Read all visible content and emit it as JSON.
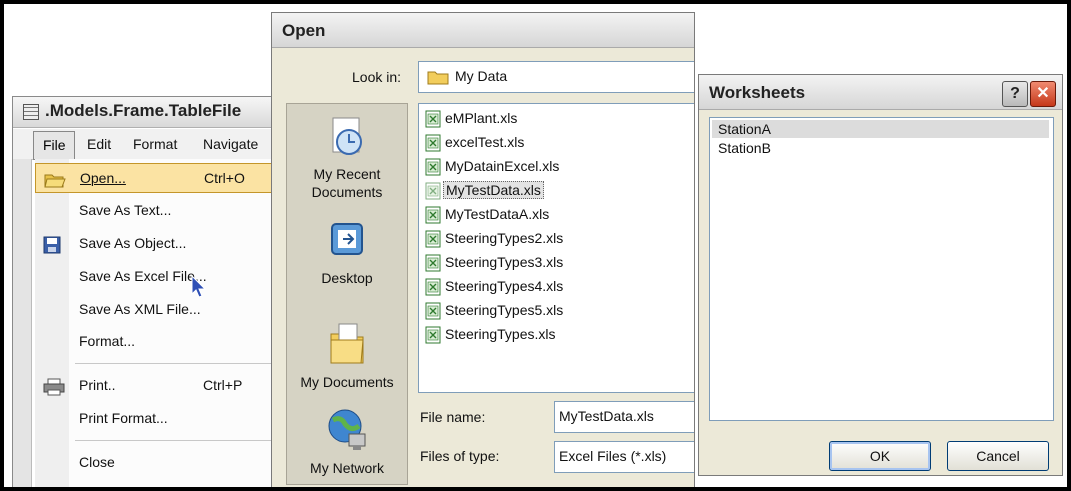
{
  "menu_window": {
    "title": ".Models.Frame.TableFile",
    "menubar": [
      "File",
      "Edit",
      "Format",
      "Navigate"
    ],
    "items": [
      {
        "label": "Open...",
        "shortcut": "Ctrl+O",
        "icon": "open-folder-icon"
      },
      {
        "label": "Save As Text...",
        "shortcut": ""
      },
      {
        "label": "Save As Object...",
        "shortcut": "",
        "icon": "floppy-disk-icon"
      },
      {
        "label": "Save As Excel File...",
        "shortcut": ""
      },
      {
        "label": "Save As XML File...",
        "shortcut": ""
      },
      {
        "label": "Format...",
        "shortcut": ""
      },
      {
        "label": "Print..",
        "shortcut": "Ctrl+P",
        "icon": "printer-icon"
      },
      {
        "label": "Print Format...",
        "shortcut": ""
      },
      {
        "label": "Close",
        "shortcut": ""
      }
    ]
  },
  "open_dialog": {
    "title": "Open",
    "look_in_label": "Look in:",
    "look_in_value": "My Data",
    "places": [
      "My Recent Documents",
      "Desktop",
      "My Documents",
      "My Network"
    ],
    "files": [
      "eMPlant.xls",
      "excelTest.xls",
      "MyDatainExcel.xls",
      "MyTestData.xls",
      "MyTestDataA.xls",
      "SteeringTypes2.xls",
      "SteeringTypes3.xls",
      "SteeringTypes4.xls",
      "SteeringTypes5.xls",
      "SteeringTypes.xls"
    ],
    "selected_file": "MyTestData.xls",
    "file_name_label": "File name:",
    "file_name_value": "MyTestData.xls",
    "file_type_label": "Files of type:",
    "file_type_value": "Excel Files (*.xls)"
  },
  "worksheets_dialog": {
    "title": "Worksheets",
    "help_label": "?",
    "close_label": "✕",
    "sheets": [
      "StationA",
      "StationB"
    ],
    "selected_sheet": "StationA",
    "ok_label": "OK",
    "cancel_label": "Cancel"
  }
}
